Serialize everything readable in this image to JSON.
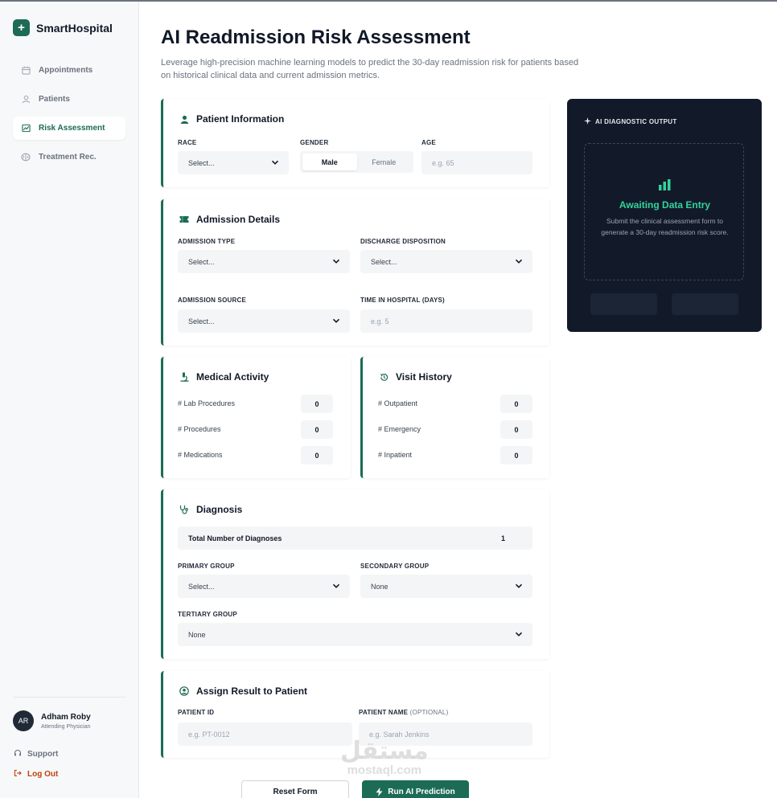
{
  "app": {
    "name": "SmartHospital"
  },
  "sidebar": {
    "items": [
      {
        "label": "Appointments",
        "icon": "calendar-icon",
        "active": false
      },
      {
        "label": "Patients",
        "icon": "user-icon",
        "active": false
      },
      {
        "label": "Risk Assessment",
        "icon": "chart-icon",
        "active": true
      },
      {
        "label": "Treatment Rec.",
        "icon": "brain-icon",
        "active": false
      }
    ],
    "user": {
      "initials": "AR",
      "name": "Adham Roby",
      "role": "Attending Physician"
    },
    "support_label": "Support",
    "logout_label": "Log Out"
  },
  "page": {
    "title": "AI Readmission Risk Assessment",
    "subtitle": "Leverage high-precision machine learning models to predict the 30-day readmission risk for patients based on historical clinical data and current admission metrics."
  },
  "patient_info": {
    "title": "Patient Information",
    "race_label": "RACE",
    "race_value": "Select...",
    "gender_label": "GENDER",
    "gender_options": [
      "Male",
      "Female"
    ],
    "gender_selected": "Male",
    "age_label": "AGE",
    "age_placeholder": "e.g. 65"
  },
  "admission": {
    "title": "Admission Details",
    "type_label": "ADMISSION TYPE",
    "type_value": "Select...",
    "discharge_label": "DISCHARGE DISPOSITION",
    "discharge_value": "Select...",
    "source_label": "ADMISSION SOURCE",
    "source_value": "Select...",
    "time_label": "TIME IN HOSPITAL (DAYS)",
    "time_placeholder": "e.g. 5"
  },
  "medical_activity": {
    "title": "Medical Activity",
    "rows": [
      {
        "label": "# Lab Procedures",
        "value": "0"
      },
      {
        "label": "# Procedures",
        "value": "0"
      },
      {
        "label": "# Medications",
        "value": "0"
      }
    ]
  },
  "visit_history": {
    "title": "Visit History",
    "rows": [
      {
        "label": "# Outpatient",
        "value": "0"
      },
      {
        "label": "# Emergency",
        "value": "0"
      },
      {
        "label": "# Inpatient",
        "value": "0"
      }
    ]
  },
  "diagnosis": {
    "title": "Diagnosis",
    "total_label": "Total Number of Diagnoses",
    "total_value": "1",
    "primary_label": "PRIMARY GROUP",
    "primary_value": "Select...",
    "secondary_label": "SECONDARY GROUP",
    "secondary_value": "None",
    "tertiary_label": "TERTIARY GROUP",
    "tertiary_value": "None"
  },
  "assign": {
    "title": "Assign Result to Patient",
    "id_label": "PATIENT ID",
    "id_placeholder": "e.g. PT-0012",
    "name_label": "PATIENT NAME",
    "name_optional": "(OPTIONAL)",
    "name_placeholder": "e.g. Sarah Jenkins"
  },
  "output_panel": {
    "header": "AI DIAGNOSTIC OUTPUT",
    "status": "Awaiting Data Entry",
    "description": "Submit the clinical assessment form to generate a 30-day readmission risk score."
  },
  "actions": {
    "reset_label": "Reset Form",
    "run_label": "Run AI Prediction"
  },
  "watermark": {
    "arabic": "مستقل",
    "latin": "mostaql.com"
  },
  "colors": {
    "accent": "#1c6b55",
    "panel_bg": "#121a2a",
    "status_green": "#34d399",
    "logout": "#c2410c"
  }
}
